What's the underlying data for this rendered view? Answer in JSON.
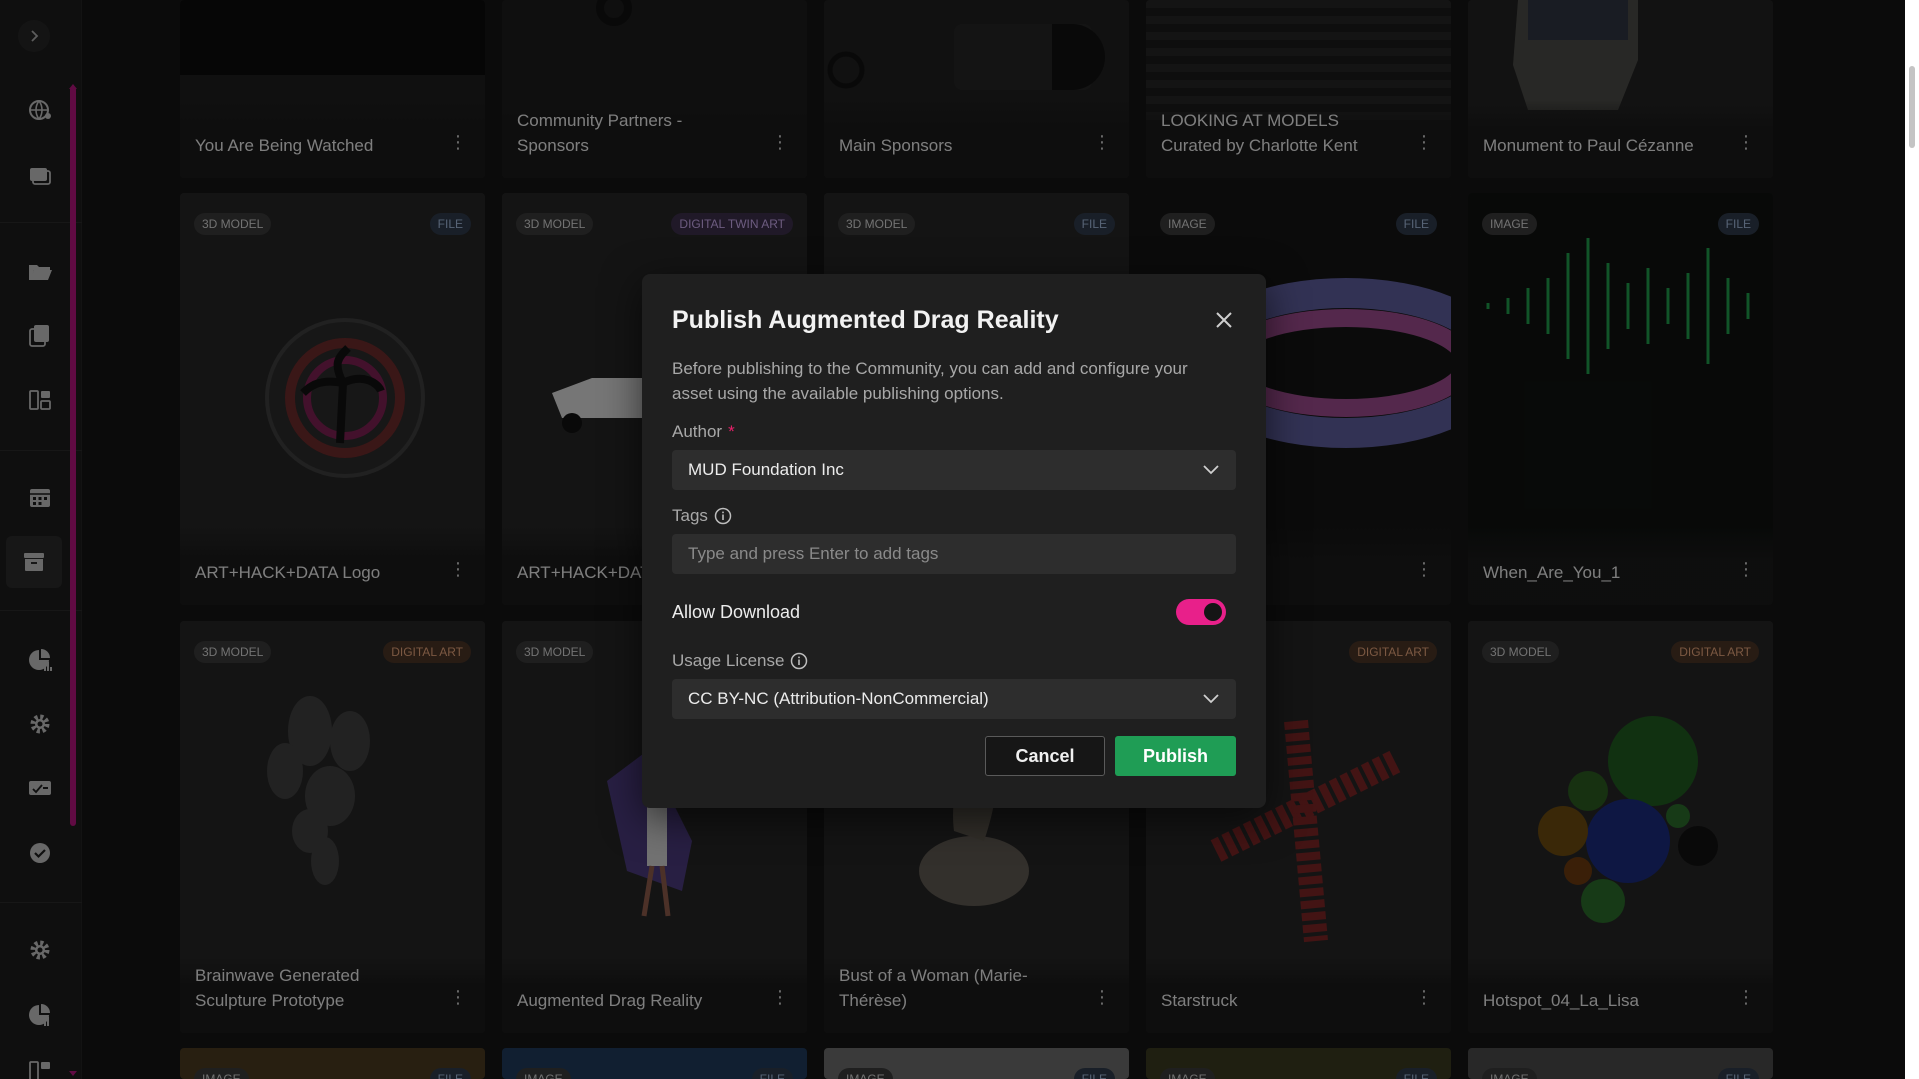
{
  "sidebar": {
    "expand_icon": "chevron-right-icon",
    "items": [
      {
        "icon": "globe-network-icon"
      },
      {
        "icon": "gallery-icon"
      },
      {
        "icon": "folder-open-icon"
      },
      {
        "icon": "collection-icon"
      },
      {
        "icon": "dashboard-icon"
      },
      {
        "icon": "calendar-icon"
      },
      {
        "icon": "archive-icon",
        "active": true
      },
      {
        "icon": "analytics-icon"
      },
      {
        "icon": "settings-icon"
      },
      {
        "icon": "ticket-icon"
      },
      {
        "icon": "check-circle-icon"
      },
      {
        "icon": "settings-icon"
      },
      {
        "icon": "analytics-icon"
      },
      {
        "icon": "dashboard-icon"
      }
    ]
  },
  "cards": {
    "row1": [
      {
        "title": "You Are Being Watched"
      },
      {
        "title": "Community Partners - Sponsors"
      },
      {
        "title": "Main Sponsors"
      },
      {
        "title": "LOOKING AT MODELS Curated by Charlotte Kent"
      },
      {
        "title": "Monument to Paul Cézanne"
      }
    ],
    "row2": [
      {
        "title": "ART+HACK+DATA Logo",
        "badge_left": "3D MODEL",
        "badge_right": "FILE"
      },
      {
        "title": "ART+HACK+DATA",
        "badge_left": "3D MODEL",
        "badge_right": "DIGITAL TWIN ART"
      },
      {
        "title": "",
        "badge_left": "3D MODEL",
        "badge_right": "FILE"
      },
      {
        "title": "",
        "badge_left": "IMAGE",
        "badge_right": "FILE"
      },
      {
        "title": "When_Are_You_1",
        "badge_left": "IMAGE",
        "badge_right": "FILE"
      }
    ],
    "row3": [
      {
        "title": "Brainwave Generated Sculpture Prototype",
        "badge_left": "3D MODEL",
        "badge_right": "DIGITAL ART"
      },
      {
        "title": "Augmented Drag Reality",
        "badge_left": "3D MODEL",
        "badge_right": ""
      },
      {
        "title": "Bust of a Woman (Marie-Thérèse)",
        "badge_left": "",
        "badge_right": ""
      },
      {
        "title": "Starstruck",
        "badge_left": "",
        "badge_right": "DIGITAL ART"
      },
      {
        "title": "Hotspot_04_La_Lisa",
        "badge_left": "3D MODEL",
        "badge_right": "DIGITAL ART"
      }
    ],
    "row4": [
      {
        "badge_left": "IMAGE",
        "badge_right": "FILE"
      },
      {
        "badge_left": "IMAGE",
        "badge_right": "FILE"
      },
      {
        "badge_left": "IMAGE",
        "badge_right": "FILE"
      },
      {
        "badge_left": "IMAGE",
        "badge_right": "FILE"
      },
      {
        "badge_left": "IMAGE",
        "badge_right": "FILE"
      }
    ],
    "menu_glyph": "⋮"
  },
  "modal": {
    "title": "Publish Augmented Drag Reality",
    "description": "Before publishing to the Community, you can add and configure your asset using the available publishing options.",
    "author_label": "Author",
    "author_required": "*",
    "author_value": "MUD Foundation Inc",
    "tags_label": "Tags",
    "tags_placeholder": "Type and press Enter to add tags",
    "allow_download_label": "Allow Download",
    "allow_download": true,
    "license_label": "Usage License",
    "license_value": "CC BY-NC (Attribution-NonCommercial)",
    "cancel_label": "Cancel",
    "publish_label": "Publish"
  },
  "colors": {
    "accent": "#e8208a",
    "publish": "#1f9d55",
    "sidebar_scroll": "#b0157a"
  }
}
